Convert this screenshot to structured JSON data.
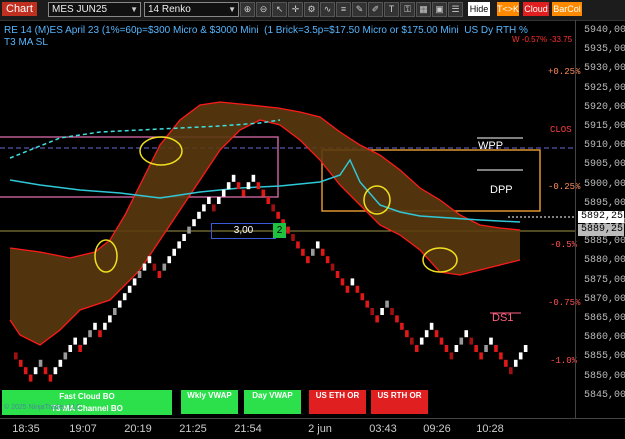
{
  "toolbar": {
    "chart_label": "Chart",
    "instrument": "MES JUN25",
    "bar_type": "14 Renko",
    "right_buttons": [
      "Hide",
      "T<>K",
      "Cloud",
      "BarCol"
    ]
  },
  "title": {
    "line1": "RE 14 (M)ES April 23 (1%=60p=$300 Micro & $3000 Mini  (1 Brick=3.5p=$17.50 Micro or $175.00 Mini  US Dy RTH %",
    "line2": "T3 MA SL",
    "overlay_red": "W -0.57% -33.75"
  },
  "y_axis": {
    "ticks": [
      "5940,00",
      "5935,00",
      "5930,00",
      "5925,00",
      "5920,00",
      "5915,00",
      "5910,00",
      "5905,00",
      "5900,00",
      "5895,00",
      "5890,00",
      "5885,00",
      "5880,00",
      "5875,00",
      "5870,00",
      "5865,00",
      "5860,00",
      "5855,00",
      "5850,00",
      "5845,00"
    ],
    "last_price": "5892,25",
    "prior_price": "5889,25"
  },
  "x_axis": {
    "ticks": [
      "18:35",
      "19:07",
      "20:19",
      "21:25",
      "21:54",
      "2 jun",
      "03:43",
      "09:26",
      "10:28"
    ]
  },
  "percent_labels": [
    {
      "text": "+0.25%",
      "color": "#ff8c5a"
    },
    {
      "text": "CLOS",
      "color": "#ff4040"
    },
    {
      "text": "-0.25%",
      "color": "#ff8c5a"
    },
    {
      "text": "-0.5%",
      "color": "#ff5050"
    },
    {
      "text": "-0.75%",
      "color": "#ff5050"
    },
    {
      "text": "-1.0%",
      "color": "#ff5050"
    }
  ],
  "levels": {
    "wpp": "WPP",
    "dpp": "DPP",
    "ds1": "DS1"
  },
  "counter": {
    "value": "3,00",
    "box": "2"
  },
  "buttons": {
    "fast_cloud": "Fast Cloud BO",
    "t3_channel": "T3 MA Channel BO",
    "wkly_vwap": "Wkly VWAP",
    "day_vwap": "Day VWAP",
    "us_eth_or": "US ETH OR",
    "us_rth_or": "US RTH OR",
    "copyright": "© 2025 NinjaTrader, LLC"
  },
  "colors": {
    "accent": "#c03020",
    "cloud": "#5a3a0e",
    "cloud_edge": "#ff1a1a",
    "ma_line": "#30c8d8"
  }
}
